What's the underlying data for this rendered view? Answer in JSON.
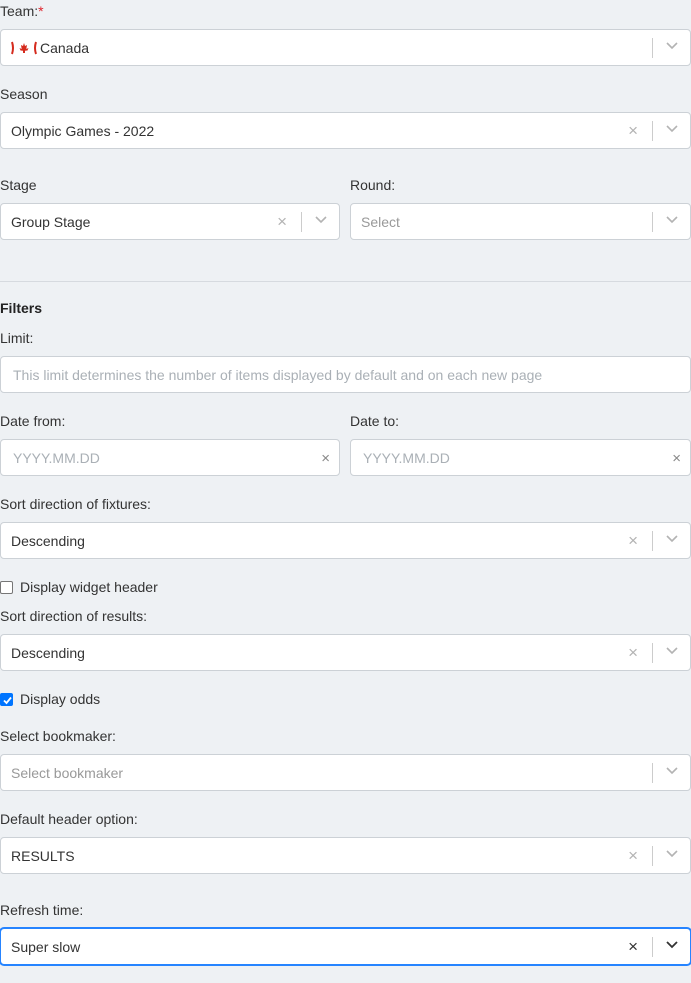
{
  "team": {
    "label": "Team:",
    "required_mark": "*",
    "value": "Canada"
  },
  "season": {
    "label": "Season",
    "value": "Olympic Games - 2022"
  },
  "stage": {
    "label": "Stage",
    "value": "Group Stage"
  },
  "round": {
    "label": "Round:",
    "placeholder": "Select"
  },
  "filters": {
    "heading": "Filters"
  },
  "limit": {
    "label": "Limit:",
    "placeholder": "This limit determines the number of items displayed by default and on each new page"
  },
  "date_from": {
    "label": "Date from:",
    "placeholder": "YYYY.MM.DD",
    "clear": "×"
  },
  "date_to": {
    "label": "Date to:",
    "placeholder": "YYYY.MM.DD",
    "clear": "×"
  },
  "sort_fixtures": {
    "label": "Sort direction of fixtures:",
    "value": "Descending"
  },
  "widget_header": {
    "label": "Display widget header",
    "checked": false
  },
  "sort_results": {
    "label": "Sort direction of results:",
    "value": "Descending"
  },
  "display_odds": {
    "label": "Display odds",
    "checked": true
  },
  "bookmaker": {
    "label": "Select bookmaker:",
    "placeholder": "Select bookmaker"
  },
  "header_option": {
    "label": "Default header option:",
    "value": "RESULTS"
  },
  "refresh": {
    "label": "Refresh time:",
    "value": "Super slow"
  },
  "icons": {
    "clear": "×",
    "dropdown": "chevron-down-icon",
    "flag": "canada-flag-icon"
  },
  "colors": {
    "background": "#eef1f4",
    "focus": "#2684ff",
    "required": "#e0262e",
    "checkbox": "#0075ff"
  }
}
